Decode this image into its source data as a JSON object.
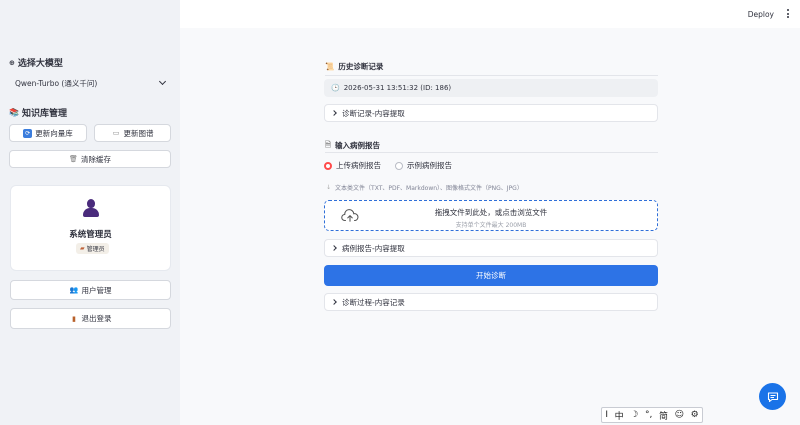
{
  "topbar": {
    "deploy_label": "Deploy"
  },
  "sidebar": {
    "model_section": {
      "icon": "⊕",
      "title": "选择大模型"
    },
    "model_select": {
      "value": "Qwen-Turbo (通义千问)"
    },
    "kb_section": {
      "icon": "📚",
      "title": "知识库管理"
    },
    "buttons": {
      "update_vector": "更新向量库",
      "update_graph": "更新图谱",
      "clear_cache": "清除缓存",
      "user_mgmt": "用户管理",
      "logout": "退出登录"
    },
    "profile": {
      "name": "系统管理员",
      "role": "管理员"
    }
  },
  "main": {
    "history": {
      "title": "历史诊断记录",
      "selected": "2026-05-31 13:51:32 (ID: 186)",
      "expander": "诊断记录-内容提取"
    },
    "input": {
      "title": "输入病例报告",
      "radio_options": [
        "上传病例报告",
        "示例病例报告"
      ],
      "hint": "文本类文件（TXT、PDF、Markdown）、图像格式文件（PNG、JPG）",
      "drop_main": "拖拽文件到此处，或点击浏览文件",
      "drop_sub": "支持单个文件最大 200MB",
      "expander": "病例报告-内容提取"
    },
    "start_button": "开始诊断",
    "process_expander": "诊断过程-内容记录"
  },
  "ime_bar": [
    "I",
    "中",
    "☽",
    "°,",
    "简",
    "☺",
    "⚙"
  ],
  "colors": {
    "primary": "#2d73e6",
    "radio_on": "#ff4b4b",
    "sidebar_bg": "#f0f2f6"
  }
}
